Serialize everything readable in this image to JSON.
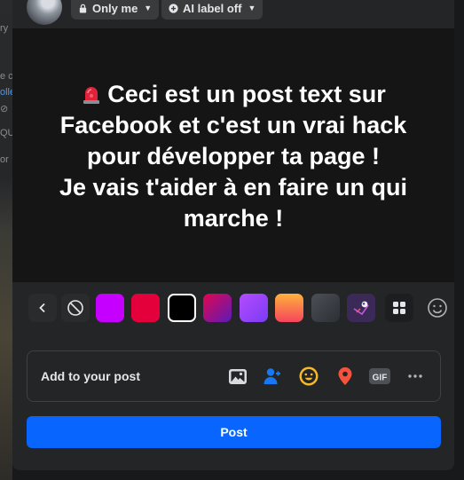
{
  "background": {
    "snippets": [
      "ry",
      "e c",
      "olle",
      "⊘",
      "QU",
      "or"
    ]
  },
  "header": {
    "audience_label": "Only me",
    "ai_label": "AI label off"
  },
  "composer": {
    "post_text": "Ceci est un post text sur\nFacebook et c'est un vrai hack\npour développer ta page !\nJe vais t'aider à en faire un qui\nmarche !",
    "leading_icon": "police-siren-emoji"
  },
  "backgrounds": {
    "swatches": [
      {
        "name": "purple",
        "color": "#c600ff"
      },
      {
        "name": "red",
        "color": "#e4003b"
      },
      {
        "name": "black",
        "color": "#000000",
        "selected": true
      },
      {
        "name": "pink-purple-gradient",
        "color": "#e2064f"
      },
      {
        "name": "violet-gradient",
        "color": "#b54bff"
      },
      {
        "name": "orange-red-gradient",
        "color": "#ffb13d"
      },
      {
        "name": "dark-gray-gradient",
        "color": "#4b4f57"
      },
      {
        "name": "illustrated",
        "color": "#3b2a57"
      }
    ]
  },
  "add_to_post": {
    "label": "Add to your post",
    "icons": [
      "photo-video-icon",
      "tag-people-icon",
      "feeling-icon",
      "check-in-icon",
      "gif-icon",
      "more-icon"
    ]
  },
  "actions": {
    "post_label": "Post",
    "accent": "#0866ff"
  }
}
